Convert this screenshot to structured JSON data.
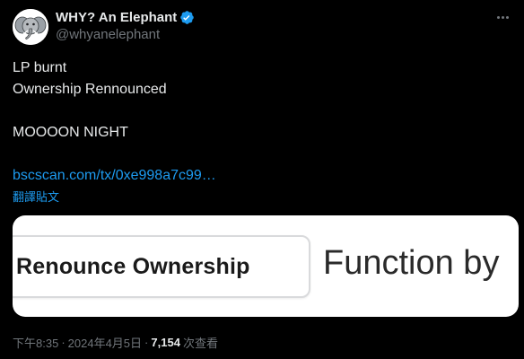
{
  "author": {
    "display_name": "WHY? An Elephant",
    "handle": "@whyanelephant",
    "verified": true
  },
  "tweet": {
    "lines": [
      "LP burnt",
      "Ownership Rennounced",
      "",
      "MOOOON NIGHT",
      ""
    ],
    "link_text": "bscscan.com/tx/0xe998a7c99…",
    "translate_label": "翻譯貼文"
  },
  "media": {
    "button_text": "Renounce Ownership",
    "trailing_text": "Function by"
  },
  "meta": {
    "time": "下午8:35",
    "date": "2024年4月5日",
    "separator": "·",
    "views_count": "7,154",
    "views_label": "次查看"
  },
  "colors": {
    "background": "#000000",
    "text_primary": "#e7e9ea",
    "text_secondary": "#71767b",
    "accent": "#1d9bf0"
  },
  "icons": {
    "verified": "verified-badge-icon",
    "more": "more-options-icon",
    "avatar": "elephant-avatar"
  }
}
